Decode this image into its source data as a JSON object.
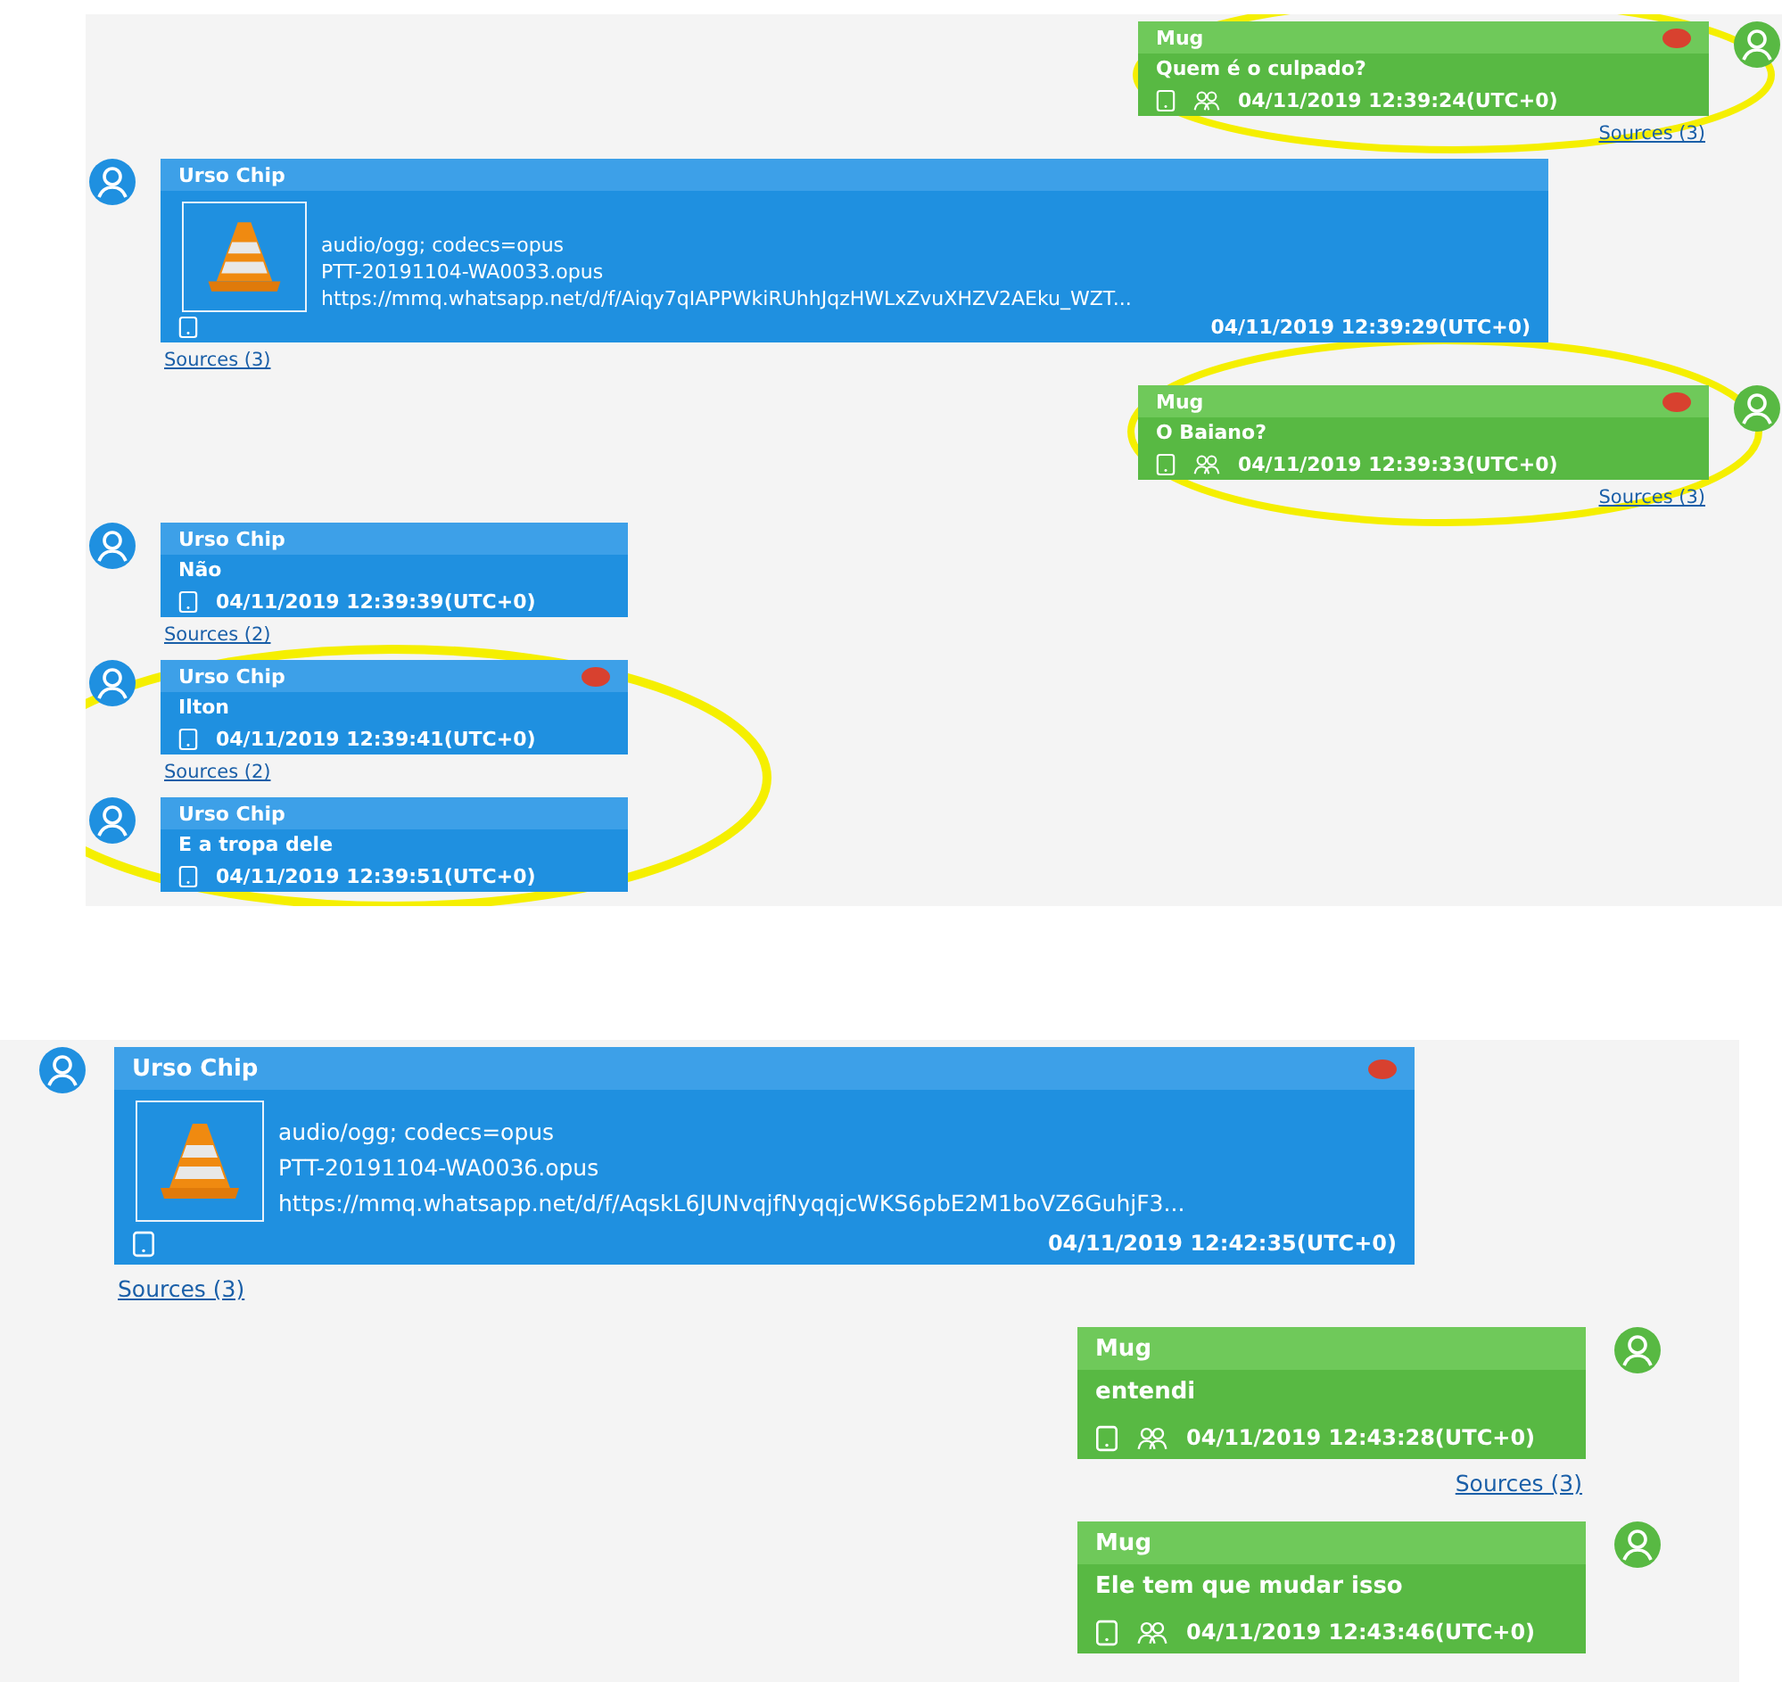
{
  "panels": [
    {
      "messages": [
        {
          "kind": "outgoing",
          "sender": "Mug",
          "flagged": true,
          "body": "Quem é o culpado?",
          "timestamp": "04/11/2019 12:39:24(UTC+0)",
          "sources": "Sources (3)"
        },
        {
          "kind": "incoming",
          "sender": "Urso Chip",
          "flagged": false,
          "attachment": {
            "mime": "audio/ogg; codecs=opus",
            "file": "PTT-20191104-WA0033.opus",
            "url": "https://mmq.whatsapp.net/d/f/Aiqy7qIAPPWkiRUhhJqzHWLxZvuXHZV2AEku_WZT..."
          },
          "timestamp": "04/11/2019 12:39:29(UTC+0)",
          "sources": "Sources (3)"
        },
        {
          "kind": "outgoing",
          "sender": "Mug",
          "flagged": true,
          "body": "O Baiano?",
          "timestamp": "04/11/2019 12:39:33(UTC+0)",
          "sources": "Sources (3)"
        },
        {
          "kind": "incoming",
          "sender": "Urso Chip",
          "flagged": false,
          "body": "Não",
          "timestamp": "04/11/2019 12:39:39(UTC+0)",
          "sources": "Sources (2)"
        },
        {
          "kind": "incoming",
          "sender": "Urso Chip",
          "flagged": true,
          "body": "Ilton",
          "timestamp": "04/11/2019 12:39:41(UTC+0)",
          "sources": "Sources (2)"
        },
        {
          "kind": "incoming",
          "sender": "Urso Chip",
          "flagged": false,
          "body": "E a tropa dele",
          "timestamp": "04/11/2019 12:39:51(UTC+0)"
        }
      ]
    },
    {
      "messages": [
        {
          "kind": "incoming",
          "sender": "Urso Chip",
          "flagged": true,
          "attachment": {
            "mime": "audio/ogg; codecs=opus",
            "file": "PTT-20191104-WA0036.opus",
            "url": "https://mmq.whatsapp.net/d/f/AqskL6JUNvqjfNyqqjcWKS6pbE2M1boVZ6GuhjF3..."
          },
          "timestamp": "04/11/2019 12:42:35(UTC+0)",
          "sources": "Sources (3)"
        },
        {
          "kind": "outgoing",
          "sender": "Mug",
          "flagged": false,
          "body": "entendi",
          "timestamp": "04/11/2019 12:43:28(UTC+0)",
          "sources": "Sources (3)"
        },
        {
          "kind": "outgoing",
          "sender": "Mug",
          "flagged": false,
          "body": "Ele tem que mudar isso",
          "timestamp": "04/11/2019 12:43:46(UTC+0)"
        }
      ]
    }
  ]
}
